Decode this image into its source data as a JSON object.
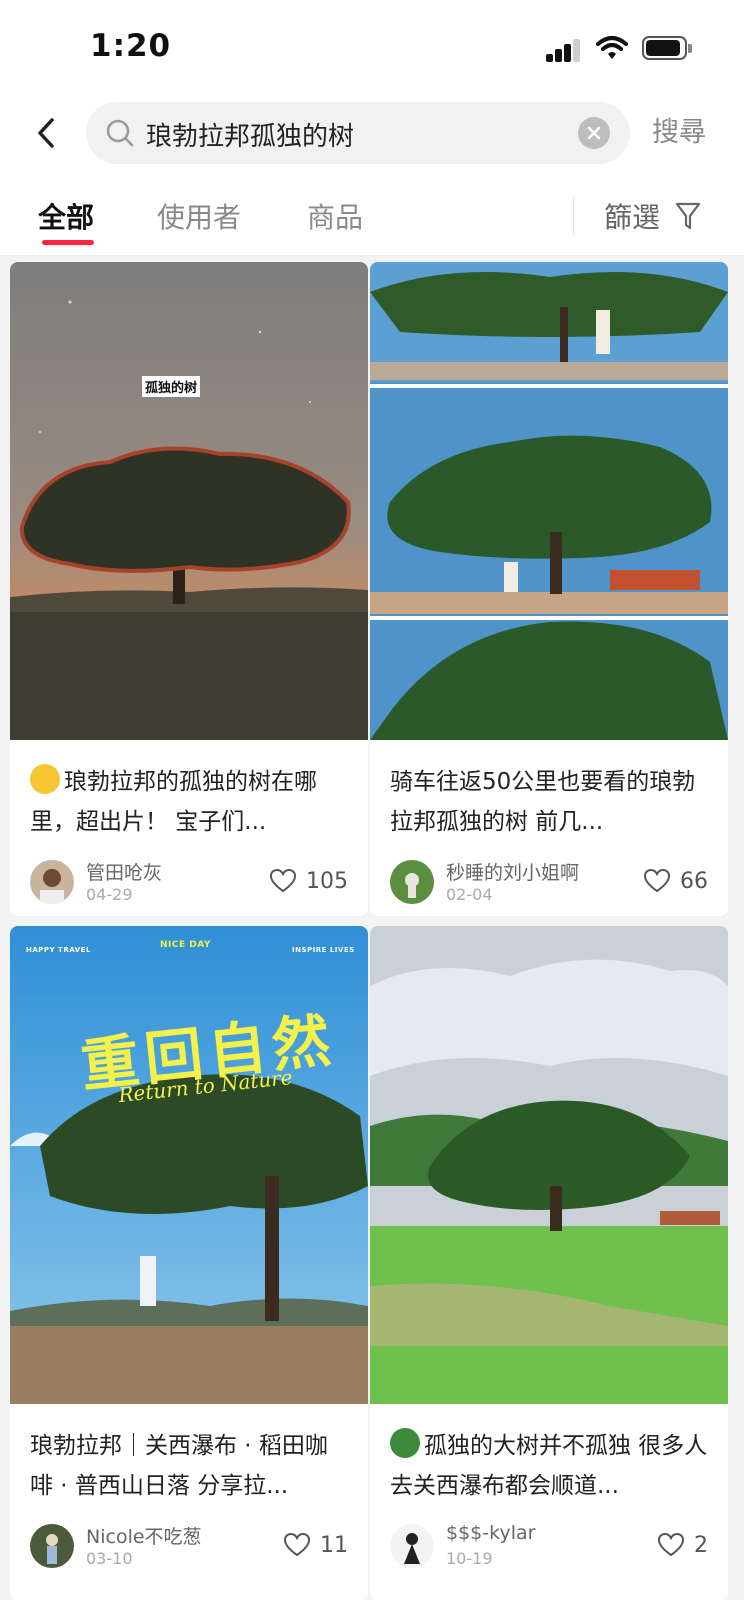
{
  "status_bar": {
    "time": "1:20"
  },
  "search": {
    "query": "琅勃拉邦孤独的树",
    "submit_label": "搜尋"
  },
  "tabs": [
    {
      "label": "全部",
      "active": true
    },
    {
      "label": "使用者",
      "active": false
    },
    {
      "label": "商品",
      "active": false
    }
  ],
  "filter": {
    "label": "篩選"
  },
  "accent_color": "#ff2442",
  "posts": [
    {
      "title": "琅勃拉邦的孤独的树在哪里，超出片！ 宝子们...",
      "title_emoji": "star-struck-emoji",
      "image_caption": "孤独的树",
      "author": "管田呛灰",
      "date": "04-29",
      "likes": "105"
    },
    {
      "title": "骑车往返50公里也要看的琅勃拉邦孤独的树 前几...",
      "author": "秒睡的刘小姐啊",
      "date": "02-04",
      "likes": "66"
    },
    {
      "title": "琅勃拉邦｜关西瀑布 · 稻田咖啡 · 普西山日落 分享拉...",
      "image_overlay": {
        "top_left": "HAPPY TRAVEL",
        "top_center": "NICE DAY",
        "top_right": "INSPIRE LIVES",
        "headline": "重回自然",
        "subline": "Return to Nature"
      },
      "author": "Nicole不吃葱",
      "date": "03-10",
      "likes": "11"
    },
    {
      "title": "孤独的大树并不孤独 很多人去关西瀑布都会顺道...",
      "title_emoji": "tree-emoji",
      "author": "$$$-kylar",
      "date": "10-19",
      "likes": "2"
    }
  ]
}
